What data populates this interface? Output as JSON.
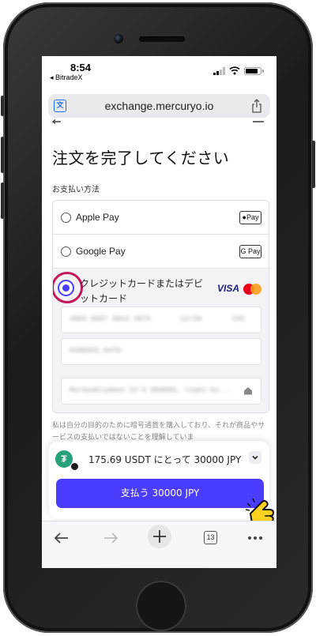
{
  "status_bar": {
    "time": "8:54",
    "back_app": "◂ BitradeX",
    "battery_level": 0.85
  },
  "browser": {
    "url": "exchange.mercuryo.io",
    "tab_count": "13"
  },
  "page": {
    "title": "注文を完了してください",
    "payment_method_label": "お支払い方法"
  },
  "payment_methods": [
    {
      "label": "Apple Pay",
      "badge": "Pay",
      "selected": false
    },
    {
      "label": "Google Pay",
      "badge": "G Pay",
      "selected": false
    },
    {
      "label": "クレジットカードまたはデビットカード",
      "selected": true
    }
  ],
  "card_brands": {
    "visa": "VISA"
  },
  "card_fields": {
    "number_blurred": "4983 0587 9843 3876",
    "expiry_blurred": "12/28",
    "cvc": "CVC",
    "name_blurred": "HIROSHI KATO",
    "address_blurred": "Murasakiyamon 22-5 960005, tsumi-ku..."
  },
  "disclaimer": "私は自分の目的のために暗号通貨を購入しており、それが商品やサービスの支払いではないことを理解していま",
  "order": {
    "quote": "175.69 USDT にとって 30000 JPY",
    "pay_button": "支払う 30000 JPY"
  },
  "icons": {
    "usdt": "usdt-tether-icon",
    "network": "tron-network-icon",
    "pointer": "pointing-hand-icon"
  },
  "colors": {
    "accent": "#4a3dff",
    "highlight_ring": "#c4165a",
    "tether": "#26a17b"
  }
}
